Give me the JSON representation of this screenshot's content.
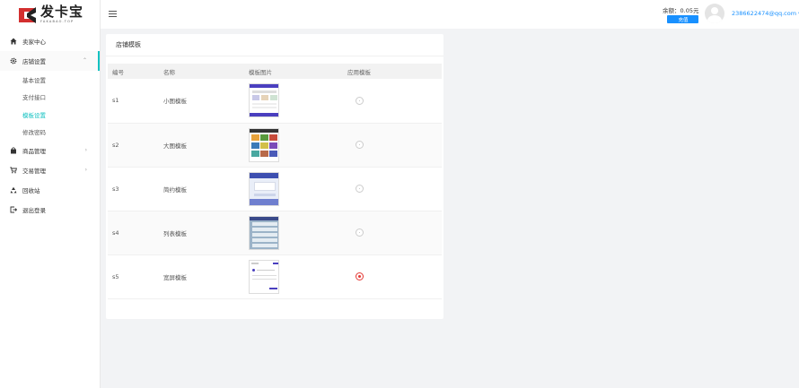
{
  "brand": {
    "name": "发卡宝",
    "sub": "FAKABAO.TOP"
  },
  "sidebar": {
    "items": [
      {
        "label": "卖家中心",
        "icon": "home-icon"
      },
      {
        "label": "店铺设置",
        "icon": "gear-icon",
        "open": true
      },
      {
        "label": "商品管理",
        "icon": "bag-icon"
      },
      {
        "label": "交易管理",
        "icon": "cart-icon"
      },
      {
        "label": "回收站",
        "icon": "recycle-icon"
      },
      {
        "label": "退出登录",
        "icon": "logout-icon"
      }
    ],
    "sub_items": [
      {
        "label": "基本设置"
      },
      {
        "label": "支付接口"
      },
      {
        "label": "模板设置",
        "active": true
      },
      {
        "label": "修改密码"
      }
    ]
  },
  "header": {
    "balance": "余额：0.05元",
    "recharge_label": "充值",
    "user": "2386622474@qq.com"
  },
  "card": {
    "title": "店铺模板",
    "columns": [
      "编号",
      "名称",
      "模板图片",
      "应用模板"
    ],
    "rows": [
      {
        "id": "s1",
        "name": "小图模板",
        "selected": false
      },
      {
        "id": "s2",
        "name": "大图模板",
        "selected": false
      },
      {
        "id": "s3",
        "name": "简约模板",
        "selected": false
      },
      {
        "id": "s4",
        "name": "列表模板",
        "selected": false
      },
      {
        "id": "s5",
        "name": "宽屏模板",
        "selected": true
      }
    ]
  },
  "colors": {
    "accent": "#13c2c2",
    "primary": "#1890ff",
    "selected_radio": "#e53935"
  }
}
